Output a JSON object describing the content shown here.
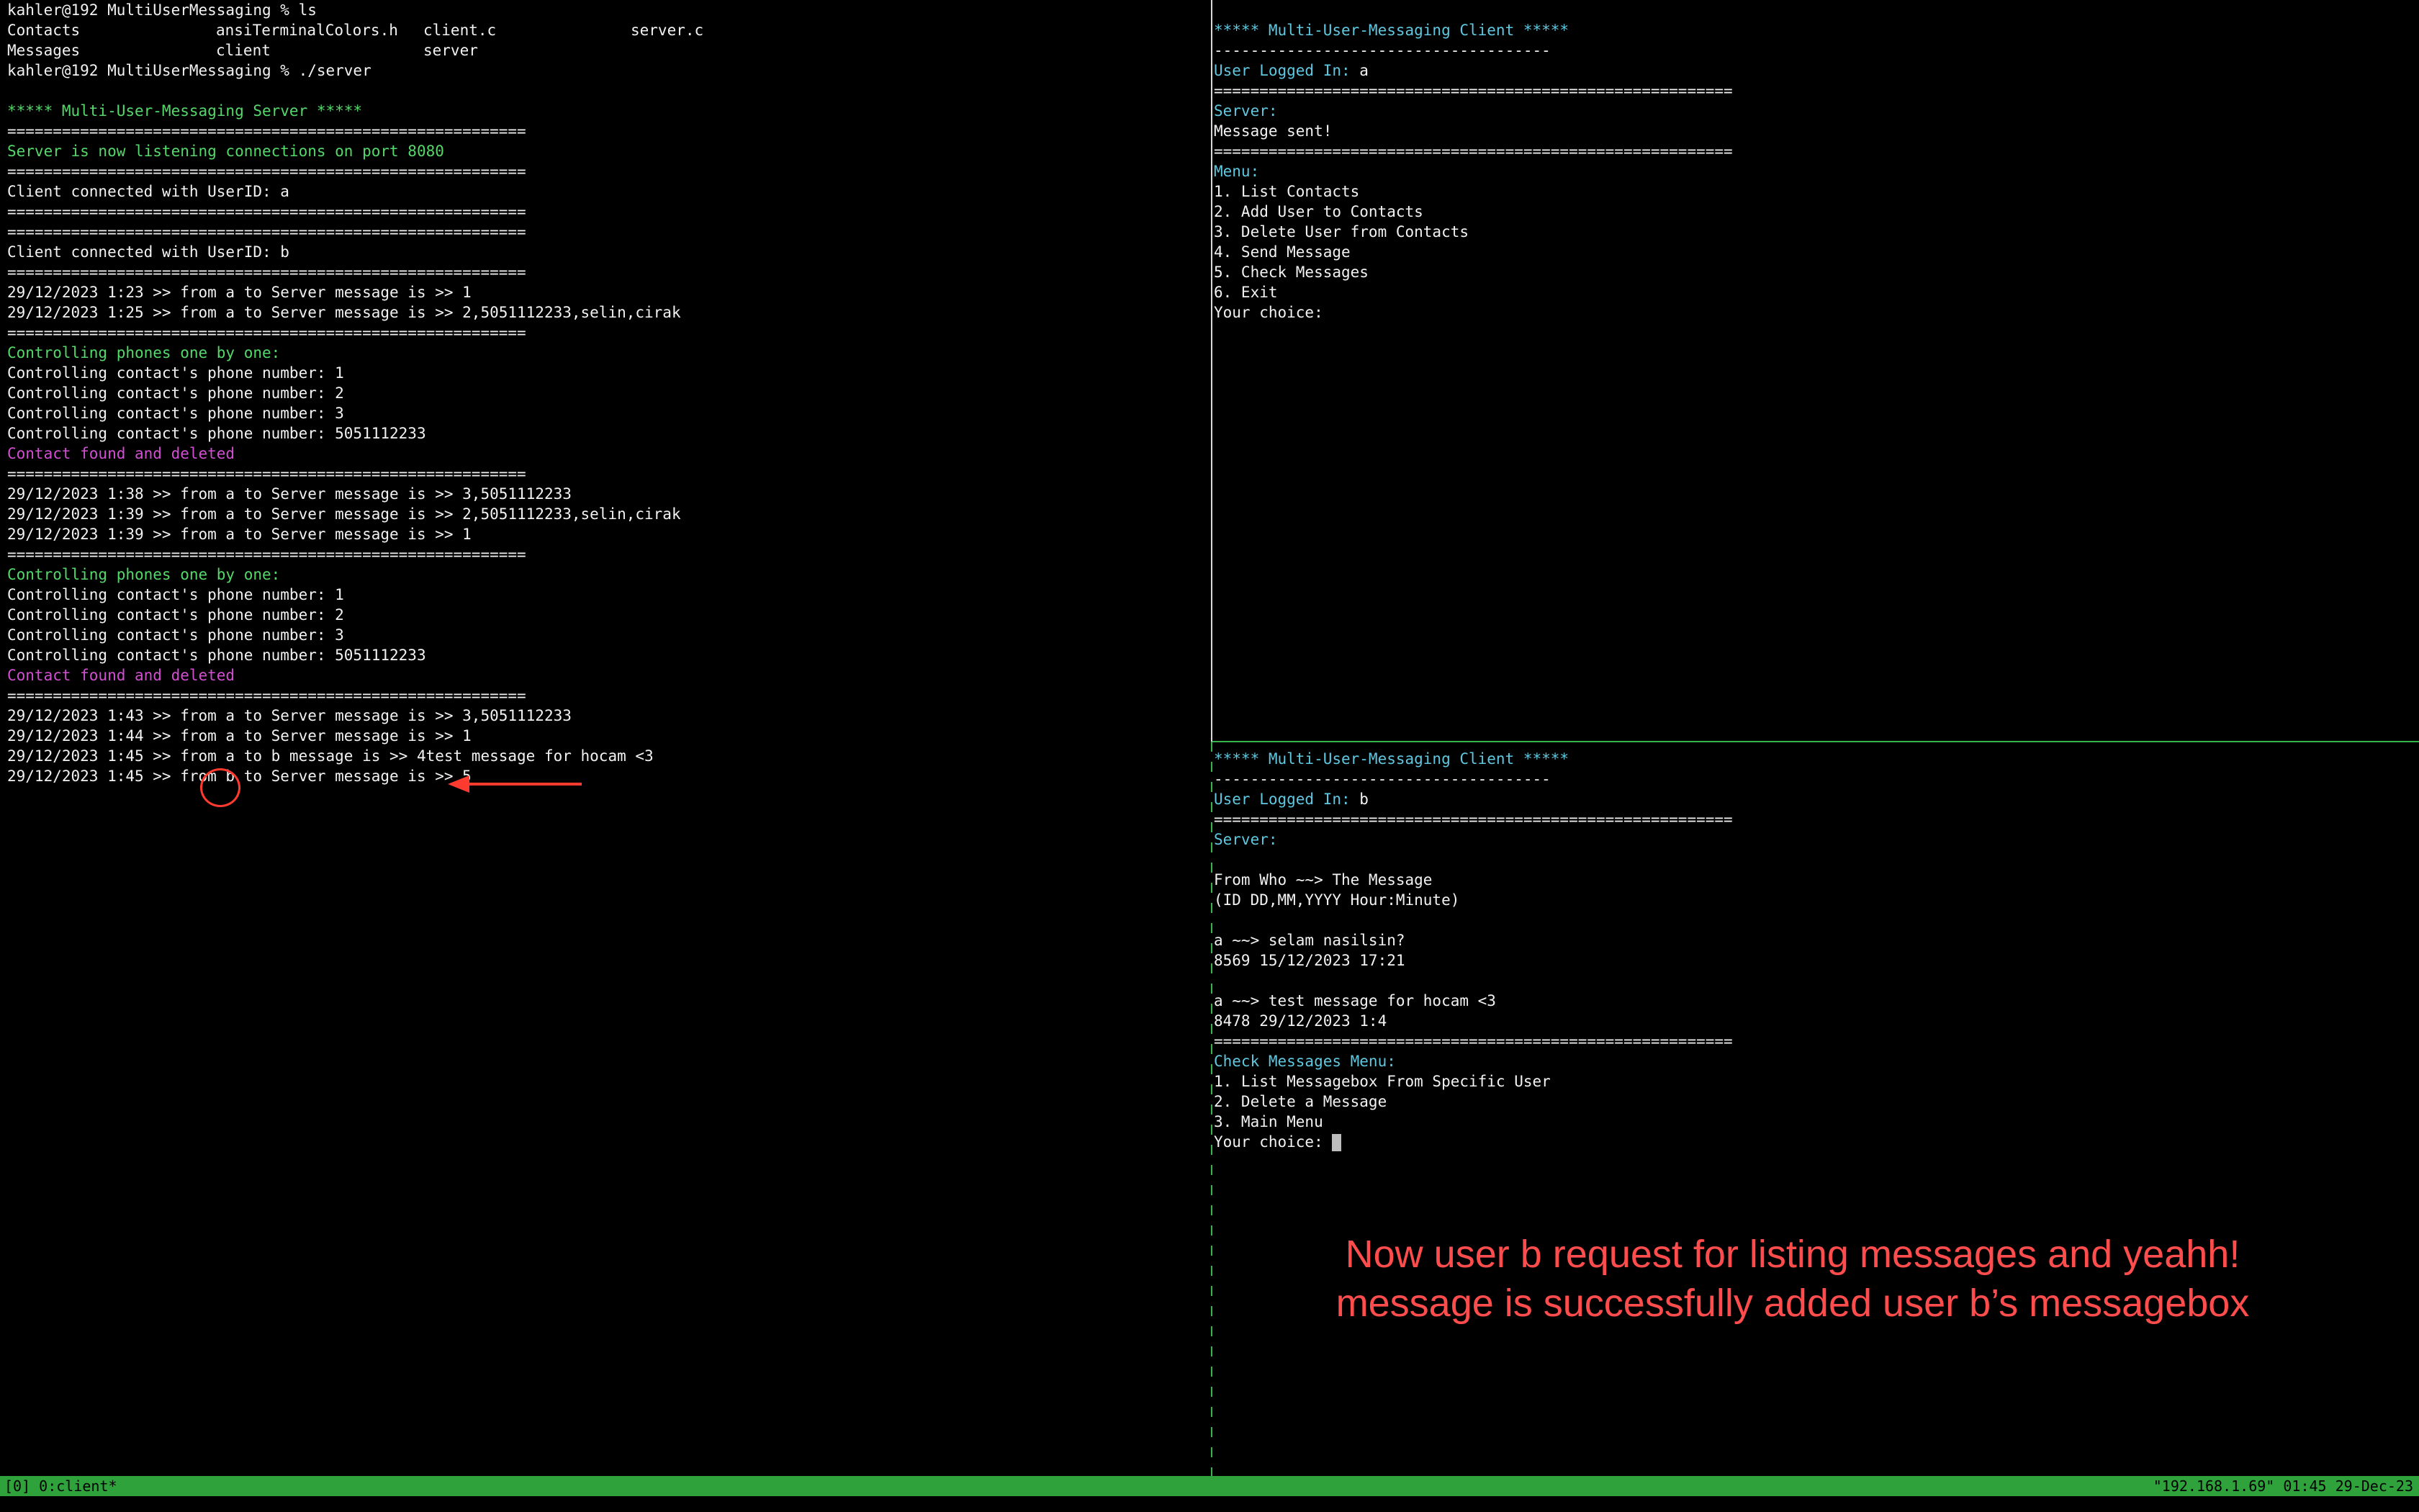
{
  "left": {
    "prompt1": "kahler@192 MultiUserMessaging % ls",
    "ls_rows": [
      [
        "Contacts",
        "ansiTerminalColors.h",
        "client.c",
        "server.c"
      ],
      [
        "Messages",
        "client",
        "server",
        ""
      ]
    ],
    "prompt2": "kahler@192 MultiUserMessaging % ./server",
    "title": "***** Multi-User-Messaging Server *****",
    "sep": "=========================================================",
    "listening": "Server is now listening connections on port 8080",
    "client_a": "Client connected with UserID: a",
    "client_b": "Client connected with UserID: b",
    "log1": "29/12/2023 1:23 >> from a to Server message is >> 1",
    "log2": "29/12/2023 1:25 >> from a to Server message is >> 2,5051112233,selin,cirak",
    "controlling_header": "Controlling phones one by one:",
    "ctrl1": "Controlling contact's phone number: 1",
    "ctrl2": "Controlling contact's phone number: 2",
    "ctrl3": "Controlling contact's phone number: 3",
    "ctrl4": "Controlling contact's phone number: 5051112233",
    "found": "Contact found and deleted",
    "log3": "29/12/2023 1:38 >> from a to Server message is >> 3,5051112233",
    "log4": "29/12/2023 1:39 >> from a to Server message is >> 2,5051112233,selin,cirak",
    "log5": "29/12/2023 1:39 >> from a to Server message is >> 1",
    "log6": "29/12/2023 1:43 >> from a to Server message is >> 3,5051112233",
    "log7": "29/12/2023 1:44 >> from a to Server message is >> 1",
    "log8": "29/12/2023 1:45 >> from a to b message is >> 4test message for hocam <3",
    "log9": "29/12/2023 1:45 >> from b to Server message is >> 5"
  },
  "right_top": {
    "title": "***** Multi-User-Messaging Client *****",
    "dash": "-------------------------------------",
    "logged_label": "User Logged In: ",
    "logged_user": "a",
    "sep": "=========================================================",
    "server_label": "Server:",
    "server_msg": "Message sent!",
    "menu_label": "Menu:",
    "menu": [
      "1. List Contacts",
      "2. Add User to Contacts",
      "3. Delete User from Contacts",
      "4. Send Message",
      "5. Check Messages",
      "6. Exit"
    ],
    "choice": "Your choice:"
  },
  "right_bottom": {
    "title": "***** Multi-User-Messaging Client *****",
    "dash": "-------------------------------------",
    "logged_label": "User Logged In: ",
    "logged_user": "b",
    "sep": "=========================================================",
    "server_label": "Server:",
    "hdr1": "From Who ~~> The Message",
    "hdr2": "(ID DD,MM,YYYY Hour:Minute)",
    "msg1_text": "a ~~> selam nasilsin?",
    "msg1_meta": "8569 15/12/2023 17:21",
    "msg2_text": "a ~~> test message for hocam <3",
    "msg2_meta": "8478 29/12/2023 1:4",
    "check_menu_label": "Check Messages Menu:",
    "check_menu": [
      "1. List Messagebox From Specific User",
      "2. Delete a Message",
      "3. Main Menu"
    ],
    "choice": "Your choice: "
  },
  "annotation": {
    "line1": "Now user b request for listing messages and yeahh!",
    "line2": "message is successfully added user b’s messagebox",
    "color": "#ff4c4c"
  },
  "status_bar": {
    "left": "[0] 0:client*",
    "right": "\"192.168.1.69\" 01:45 29-Dec-23",
    "color": "#2fa23b"
  }
}
